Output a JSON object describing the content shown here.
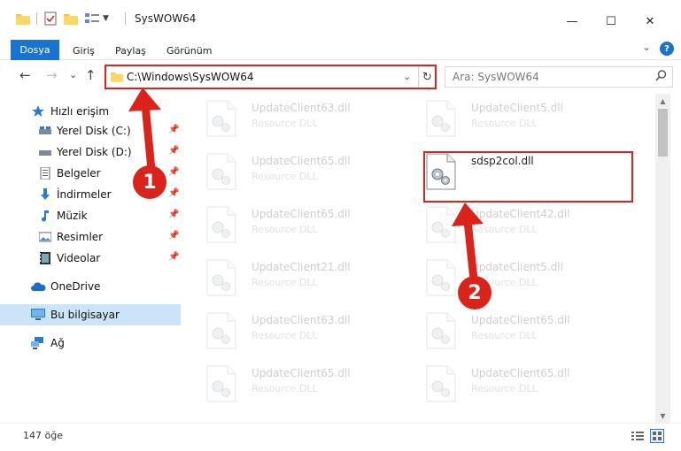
{
  "window": {
    "title": "SysWOW64",
    "minimize": "—",
    "maximize": "☐",
    "close": "✕"
  },
  "ribbon": {
    "tabs": [
      "Dosya",
      "Giriş",
      "Paylaş",
      "Görünüm"
    ],
    "collapse": "⌄",
    "help": "?"
  },
  "nav": {
    "back": "←",
    "forward": "→",
    "recent": "⌄",
    "up": "↑",
    "address": "C:\\Windows\\SysWOW64",
    "address_dropdown": "⌄",
    "refresh": "↻",
    "search_placeholder": "Ara: SysWOW64",
    "search_icon": "search-icon"
  },
  "sidebar": {
    "items": [
      {
        "label": "Hızlı erişim",
        "icon": "star-icon",
        "pinned": false
      },
      {
        "label": "Yerel Disk (C:)",
        "icon": "drive-icon",
        "pinned": true
      },
      {
        "label": "Yerel Disk (D:)",
        "icon": "drive-icon",
        "pinned": true
      },
      {
        "label": "Belgeler",
        "icon": "document-icon",
        "pinned": true
      },
      {
        "label": "İndirmeler",
        "icon": "download-icon",
        "pinned": true
      },
      {
        "label": "Müzik",
        "icon": "music-icon",
        "pinned": true
      },
      {
        "label": "Resimler",
        "icon": "pictures-icon",
        "pinned": true
      },
      {
        "label": "Videolar",
        "icon": "video-icon",
        "pinned": true
      },
      {
        "label": "OneDrive",
        "icon": "cloud-icon",
        "pinned": false
      },
      {
        "label": "Bu bilgisayar",
        "icon": "computer-icon",
        "pinned": false,
        "selected": true
      },
      {
        "label": "Ağ",
        "icon": "network-icon",
        "pinned": false
      }
    ],
    "pin_glyph": "📌"
  },
  "files": {
    "left_column": [
      {
        "name": "UpdateClient63.dll",
        "type": "Resource DLL"
      },
      {
        "name": "UpdateClient65.dll",
        "type": "Resource DLL"
      },
      {
        "name": "UpdateClient65.dll",
        "type": "Resource DLL"
      },
      {
        "name": "UpdateClient21.dll",
        "type": "Resource DLL"
      },
      {
        "name": "UpdateClient63.dll",
        "type": "Resource DLL"
      },
      {
        "name": "UpdateClient65.dll",
        "type": "Resource DLL"
      }
    ],
    "right_column": [
      {
        "name": "UpdateClient5.dll",
        "type": "Resource DLL"
      },
      {
        "name": "sdsp2col.dll",
        "type": "",
        "highlighted": true
      },
      {
        "name": "UpdateClient42.dll",
        "type": "Resource DLL"
      },
      {
        "name": "UpdateClient5.dll",
        "type": "Resource DLL"
      },
      {
        "name": "UpdateClient65.dll",
        "type": "Resource DLL"
      },
      {
        "name": "UpdateClient65.dll",
        "type": "Resource DLL"
      }
    ]
  },
  "annotations": {
    "step1": "1",
    "step2": "2",
    "color": "#d9231b"
  },
  "status": {
    "count": "147 öğe"
  },
  "colors": {
    "accent": "#1a73d1",
    "selection": "#cce4f7",
    "annotation": "#d9231b"
  }
}
